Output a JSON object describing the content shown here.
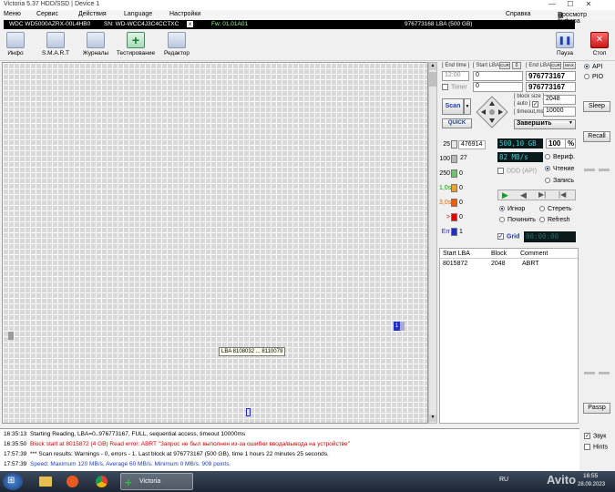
{
  "window": {
    "title": "Victoria 5.37 HDD/SSD | Device 1",
    "controls": {
      "minimize": "—",
      "maximize": "☐",
      "close": "✕"
    }
  },
  "menu": {
    "items": [
      "Меню",
      "Сервис",
      "Действия",
      "Language",
      "Настройки"
    ],
    "help": "Справка",
    "clipboard": "Просмотр буфера"
  },
  "device": {
    "model": "WDC WD5000AZRX-00L4HB0",
    "serial": "SN: WD-WCC4J3C4CCTXC",
    "close": "x",
    "firmware": "Fw: 01.01A01",
    "capacity": "976773168 LBA (500 GB)"
  },
  "toolbar": {
    "buttons": [
      "Инфо",
      "S.M.A.R.T",
      "Журналы",
      "Тестирование",
      "Редактор"
    ],
    "pause": "Пауза",
    "stop": "Стоп"
  },
  "grid": {
    "marker_label": "1",
    "tooltip": "LBA  8108032 ... 8110079"
  },
  "scan": {
    "end_time_label": "[ End time ]",
    "start_lba_label": "[ Start LBA ]",
    "cur_label": "CUR",
    "zero_label": "0",
    "end_lba_label": "[ End LBA ]",
    "cur2_label": "CUR",
    "max_label": "MAX",
    "end_time_value": "12:00",
    "start_lba_value": "0",
    "end_lba_value": "976773167",
    "timer_label": "Timer",
    "timer_value": "0",
    "end_lba_value2": "976773167",
    "scan_button": "Scan",
    "quick_button": "QUICK",
    "block_size_label": "[ block size ]",
    "auto_label": "[ auto ]",
    "timeout_label": "[ timeout,ms ]",
    "block_size_value": "2048",
    "timeout_value": "10000",
    "finish_action": "Завершить"
  },
  "legend": [
    {
      "label": "25",
      "count": "476914",
      "color": "#e8e8e8"
    },
    {
      "label": "100",
      "count": "27",
      "color": "#b8b8b8"
    },
    {
      "label": "250",
      "count": "0",
      "color": "#6fc36f"
    },
    {
      "label": "1,0s",
      "count": "0",
      "color": "#f0a030"
    },
    {
      "label": "3,0s",
      "count": "0",
      "color": "#f05a00"
    },
    {
      "label": ">",
      "count": "0",
      "color": "#e00000"
    },
    {
      "label": "Err",
      "count": "1",
      "color": "#2030c0"
    }
  ],
  "status": {
    "size": "500,10 GB",
    "percent": "100",
    "percent_unit": "%",
    "speed": "82 MB/s",
    "ddd_label": "DDD (API)",
    "verify": "Вериф.",
    "read": "Чтение",
    "write": "Запись",
    "ignore": "Игнор",
    "erase": "Стереть",
    "repair": "Починить",
    "refresh": "Refresh",
    "grid_label": "Grid",
    "elapsed": "00:00:00"
  },
  "table": {
    "headers": [
      "Start LBA",
      "Block",
      "Comment"
    ],
    "rows": [
      [
        "8015872",
        "2048",
        "ABRT"
      ]
    ]
  },
  "right_panel": {
    "api": "API",
    "pio": "PIO",
    "sleep": "Sleep",
    "recall": "Recall",
    "passp": "Passp",
    "sound": "Звук",
    "hints": "Hints"
  },
  "log": [
    {
      "time": "16:35:13",
      "text": "Starting Reading, LBA=0..976773167, FULL, sequential access, timeout 10000ms",
      "color": "#000000"
    },
    {
      "time": "16:35:50",
      "text": "Block start at 8015872 (4 GB) Read error: ABRT \"Запрос не был выполнен из-за ошибки ввода/вывода на устройстве\"",
      "color": "#d00000"
    },
    {
      "time": "17:57:39",
      "text": "*** Scan results: Warnings - 0, errors - 1. Last block at 976773167 (500 GB), time 1 hours 22 minutes 25 seconds.",
      "color": "#000000"
    },
    {
      "time": "17:57:39",
      "text": "Speed: Maximum 120 MB/s. Average 60 MB/s. Minimum 0 MB/s. 909 points.",
      "color": "#1a3fd0"
    }
  ],
  "taskbar": {
    "app_label": "Victoria",
    "lang": "RU",
    "time": "16:55",
    "date": "28.09.2023",
    "watermark": "Avito"
  }
}
